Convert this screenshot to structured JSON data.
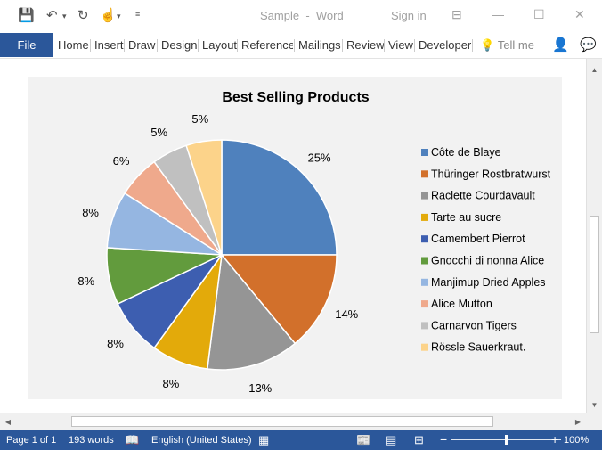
{
  "window": {
    "document_title": "Sample",
    "title_separator": "-",
    "app_name": "Word",
    "sign_in": "Sign in"
  },
  "ribbon": {
    "file": "File",
    "tabs": [
      "Home",
      "Insert",
      "Draw",
      "Design",
      "Layout",
      "References",
      "Mailings",
      "Review",
      "View",
      "Developer"
    ],
    "tell_me": "Tell me"
  },
  "status": {
    "page": "Page 1 of 1",
    "words": "193 words",
    "language": "English (United States)",
    "zoom": "100%",
    "zoom_level": 1.0
  },
  "chart_data": {
    "type": "pie",
    "title": "Best Selling Products",
    "legend_position": "right",
    "series": [
      {
        "name": "Côte de Blaye",
        "value": 25,
        "label": "25%",
        "color": "#4f81bd"
      },
      {
        "name": "Thüringer Rostbratwurst",
        "value": 14,
        "label": "14%",
        "color": "#d2702b"
      },
      {
        "name": "Raclette Courdavault",
        "value": 13,
        "label": "13%",
        "color": "#959595"
      },
      {
        "name": "Tarte au sucre",
        "value": 8,
        "label": "8%",
        "color": "#e3aa0a"
      },
      {
        "name": "Camembert Pierrot",
        "value": 8,
        "label": "8%",
        "color": "#3d5eb0"
      },
      {
        "name": "Gnocchi di nonna Alice",
        "value": 8,
        "label": "8%",
        "color": "#629b3d"
      },
      {
        "name": "Manjimup Dried Apples",
        "value": 8,
        "label": "8%",
        "color": "#95b6e1"
      },
      {
        "name": "Alice Mutton",
        "value": 6,
        "label": "6%",
        "color": "#efa98c"
      },
      {
        "name": "Carnarvon Tigers",
        "value": 5,
        "label": "5%",
        "color": "#c0c0c0"
      },
      {
        "name": "Rössle Sauerkraut.",
        "value": 5,
        "label": "5%",
        "color": "#fcd38a"
      }
    ]
  }
}
